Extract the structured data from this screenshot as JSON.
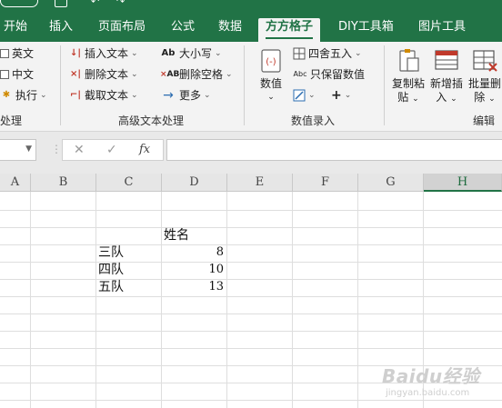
{
  "ribbon_tabs": [
    "开始",
    "插入",
    "页面布局",
    "公式",
    "数据",
    "方方格子",
    "DIY工具箱",
    "图片工具"
  ],
  "active_tab": "方方格子",
  "text_group": {
    "items": [
      "英文",
      "中文",
      "执行"
    ],
    "label": "处理"
  },
  "advanced_text_group": {
    "insert_text": "插入文本",
    "delete_text": "删除文本",
    "extract_text": "截取文本",
    "case": "大小写",
    "delete_spaces": "删除空格",
    "more": "更多",
    "label": "高级文本处理"
  },
  "number_group": {
    "numeric": "数值",
    "round": "四舍五入",
    "keep_numbers": "只保留数值",
    "plus": "+",
    "label": "数值录入"
  },
  "edit_group": {
    "copy_paste_1": "复制粘",
    "copy_paste_2": "贴",
    "add_insert_1": "新增插",
    "add_insert_2": "入",
    "batch_delete_1": "批量删",
    "batch_delete_2": "除",
    "label": "编辑"
  },
  "formula_bar": {
    "cancel": "✕",
    "confirm": "✓",
    "fx": "fx",
    "value": ""
  },
  "columns": [
    "A",
    "B",
    "C",
    "D",
    "E",
    "F",
    "G",
    "H"
  ],
  "selected_column": "H",
  "cells": {
    "d_header": "姓名",
    "rows": [
      {
        "team": "三队",
        "value": "8"
      },
      {
        "team": "四队",
        "value": "10"
      },
      {
        "team": "五队",
        "value": "13"
      }
    ]
  },
  "watermark": {
    "main": "Baidu经验",
    "sub": "jingyan.baidu.com"
  }
}
